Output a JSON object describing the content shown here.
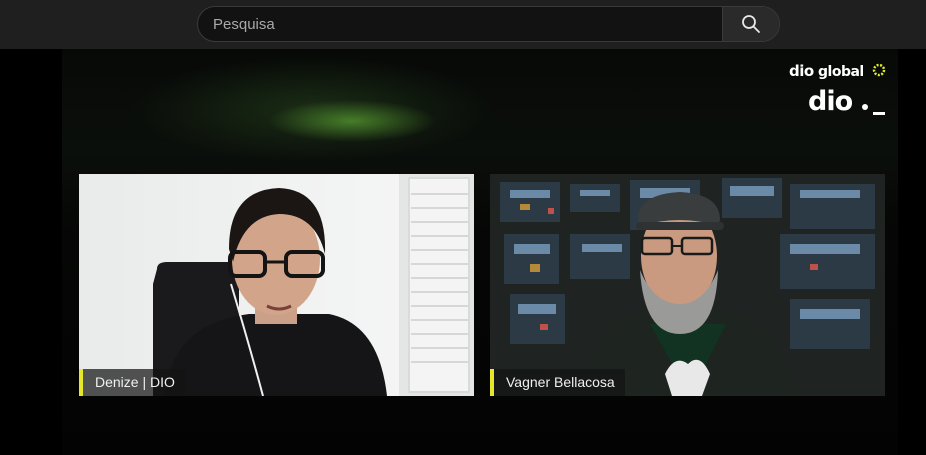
{
  "search": {
    "placeholder": "Pesquisa"
  },
  "icons": {
    "search": "search-icon"
  },
  "branding": {
    "logo_top": "dioglobal",
    "logo_bottom": "DIO._"
  },
  "participants": [
    {
      "name": "Denize | DIO"
    },
    {
      "name": "Vagner Bellacosa"
    }
  ],
  "colors": {
    "name_accent": "#e6e62a",
    "logo_accent": "#e4ea2a",
    "topbar": "#1f1f1f"
  }
}
